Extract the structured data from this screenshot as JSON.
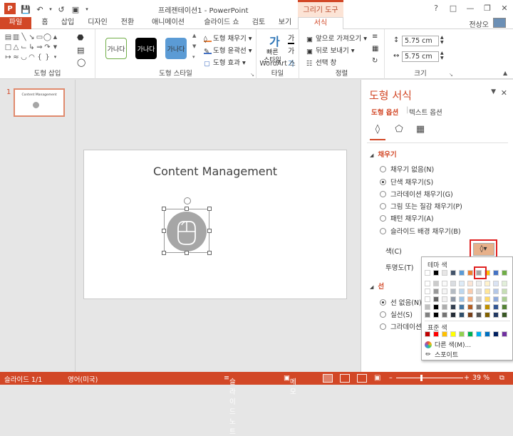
{
  "window": {
    "title": "프레젠테이션1 - PowerPoint",
    "contextual_tab": "그리기 도구",
    "user": "전상오",
    "help": "?"
  },
  "tabs": [
    {
      "label": "파일"
    },
    {
      "label": "홈"
    },
    {
      "label": "삽입"
    },
    {
      "label": "디자인"
    },
    {
      "label": "전환"
    },
    {
      "label": "애니메이션"
    },
    {
      "label": "슬라이드 쇼"
    },
    {
      "label": "검토"
    },
    {
      "label": "보기"
    },
    {
      "label": "서식"
    }
  ],
  "ribbon": {
    "groups": {
      "insert_shapes": "도형 삽입",
      "shape_styles": "도형 스타일",
      "wordart_styles": "WordArt 스타일",
      "arrange": "정렬",
      "size": "크기"
    },
    "style_samples": [
      "가나다",
      "가나다",
      "가나다"
    ],
    "shape_fill": "도형 채우기",
    "shape_outline": "도형 윤곽선",
    "shape_effects": "도형 효과",
    "quick_styles": "빠른\n스타일",
    "bring_forward": "앞으로 가져오기",
    "send_backward": "뒤로 보내기",
    "selection_pane": "선택 창",
    "height": "5.75 cm",
    "width": "5.75 cm"
  },
  "slides_panel": {
    "slide_number": "1",
    "thumb_title": "Content Management"
  },
  "slide": {
    "title": "Content Management"
  },
  "pane": {
    "title": "도형 서식",
    "tab_shape_options": "도형 옵션",
    "tab_text_options": "텍스트 옵션",
    "fill_section": "채우기",
    "fill_options": [
      {
        "label": "채우기 없음(N)",
        "selected": false
      },
      {
        "label": "단색 채우기(S)",
        "selected": true
      },
      {
        "label": "그라데이션 채우기(G)",
        "selected": false
      },
      {
        "label": "그림 또는 질감 채우기(P)",
        "selected": false
      },
      {
        "label": "패턴 채우기(A)",
        "selected": false
      },
      {
        "label": "슬라이드 배경 채우기(B)",
        "selected": false
      }
    ],
    "color_label": "색(C)",
    "transparency_label": "투명도(T)",
    "line_section": "선",
    "line_options": [
      {
        "label": "선 없음(N)",
        "selected": true
      },
      {
        "label": "실선(S)",
        "selected": false
      },
      {
        "label": "그라데이션",
        "selected": false
      }
    ]
  },
  "palette": {
    "theme_colors_label": "테마 색",
    "standard_colors_label": "표준 색",
    "more_colors": "다른 색(M)...",
    "eyedropper": "스포이트",
    "theme_colors": [
      "#ffffff",
      "#000000",
      "#e7e6e6",
      "#44546a",
      "#5b9bd5",
      "#ed7d31",
      "#a5a5a5",
      "#ffc000",
      "#4472c4",
      "#70ad47"
    ],
    "standard_colors": [
      "#c00000",
      "#ff0000",
      "#ffc000",
      "#ffff00",
      "#92d050",
      "#00b050",
      "#00b0f0",
      "#0070c0",
      "#002060",
      "#7030a0"
    ]
  },
  "status": {
    "slide_info": "슬라이드 1/1",
    "language": "영어(미국)",
    "notes": "슬라이드 노트",
    "comments": "메모",
    "zoom": "39 %"
  }
}
